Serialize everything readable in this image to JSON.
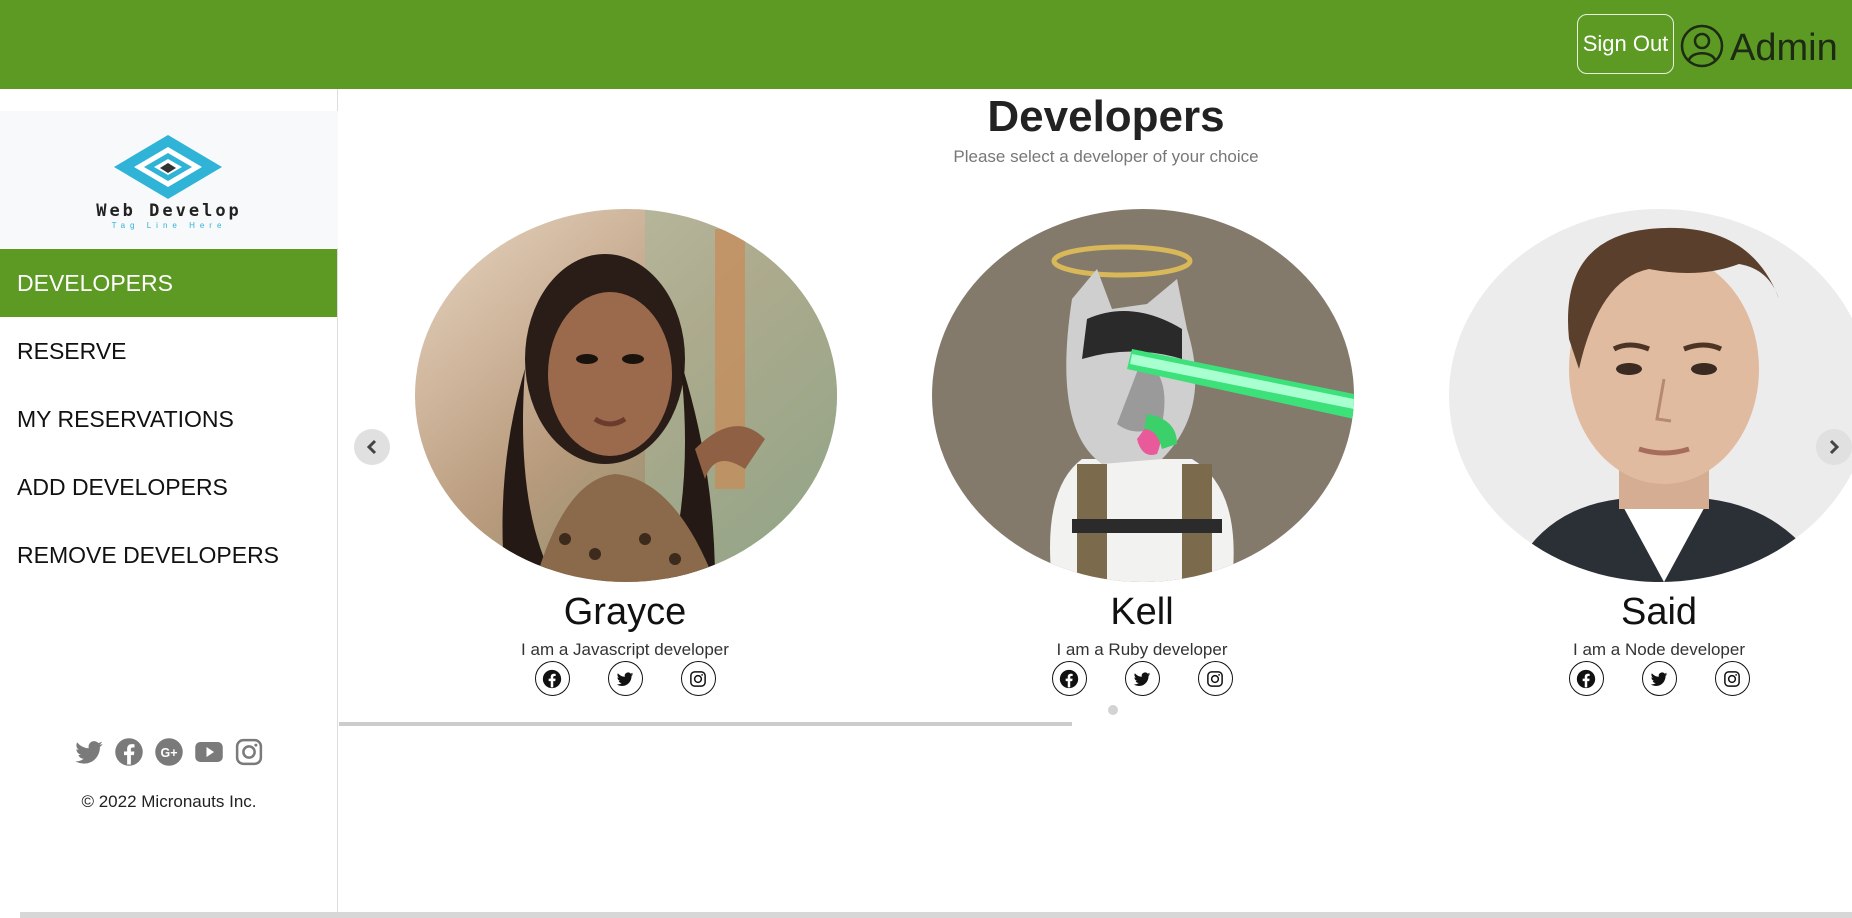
{
  "header": {
    "signout_label": "Sign Out",
    "user_label": "Admin",
    "bg_color": "#5c9a24"
  },
  "sidebar": {
    "logo": {
      "name": "Web Develop",
      "tagline": "Tag Line Here"
    },
    "items": [
      {
        "label": "DEVELOPERS",
        "active": true
      },
      {
        "label": "RESERVE",
        "active": false
      },
      {
        "label": "MY RESERVATIONS",
        "active": false
      },
      {
        "label": "ADD DEVELOPERS",
        "active": false
      },
      {
        "label": "REMOVE DEVELOPERS",
        "active": false
      }
    ],
    "social_icons": [
      "twitter-icon",
      "facebook-icon",
      "google-plus-icon",
      "youtube-icon",
      "instagram-icon"
    ],
    "copyright": "© 2022 Micronauts Inc."
  },
  "main": {
    "title": "Developers",
    "subtitle": "Please select a developer of your choice",
    "developers": [
      {
        "name": "Grayce",
        "role": "I am a Javascript developer"
      },
      {
        "name": "Kell",
        "role": "I am a Ruby developer"
      },
      {
        "name": "Said",
        "role": "I am a Node developer"
      }
    ],
    "card_social_icons": [
      "facebook-icon",
      "twitter-icon",
      "instagram-icon"
    ]
  }
}
